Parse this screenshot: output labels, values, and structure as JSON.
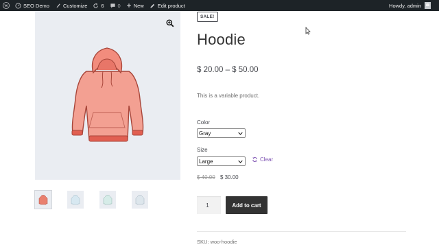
{
  "admin_bar": {
    "site_name": "SEO Demo",
    "customize": "Customize",
    "updates_count": "6",
    "comments_count": "0",
    "new_label": "New",
    "edit_product": "Edit product",
    "greeting": "Howdy, admin"
  },
  "product": {
    "badge": "SALE!",
    "title": "Hoodie",
    "price_range": "$ 20.00 – $ 50.00",
    "short_description": "This is a variable product.",
    "attributes": {
      "color_label": "Color",
      "color_value": "Gray",
      "size_label": "Size",
      "size_value": "Large"
    },
    "clear_label": "Clear",
    "variation_old_price": "$ 40.00",
    "variation_new_price": "$ 30.00",
    "quantity": "1",
    "add_to_cart": "Add to cart",
    "sku": "SKU: woo-hoodie"
  },
  "gallery": {
    "main_image_icon": "hoodie-image",
    "zoom_icon": "magnifier-plus-icon",
    "thumbnails": [
      {
        "icon": "hoodie-thumbnail",
        "color": "#e9806f"
      },
      {
        "icon": "hoodie-thumbnail",
        "color": "#cfe2ec"
      },
      {
        "icon": "hoodie-thumbnail",
        "color": "#cfe7e4"
      },
      {
        "icon": "hoodie-thumbnail",
        "color": "#d8e2ea"
      }
    ]
  },
  "colors": {
    "admin_bar_bg": "#1d2327",
    "gallery_bg": "#eaedf2",
    "hoodie": "#f28c7d",
    "button_bg": "#333333",
    "link": "#7f54b3"
  }
}
